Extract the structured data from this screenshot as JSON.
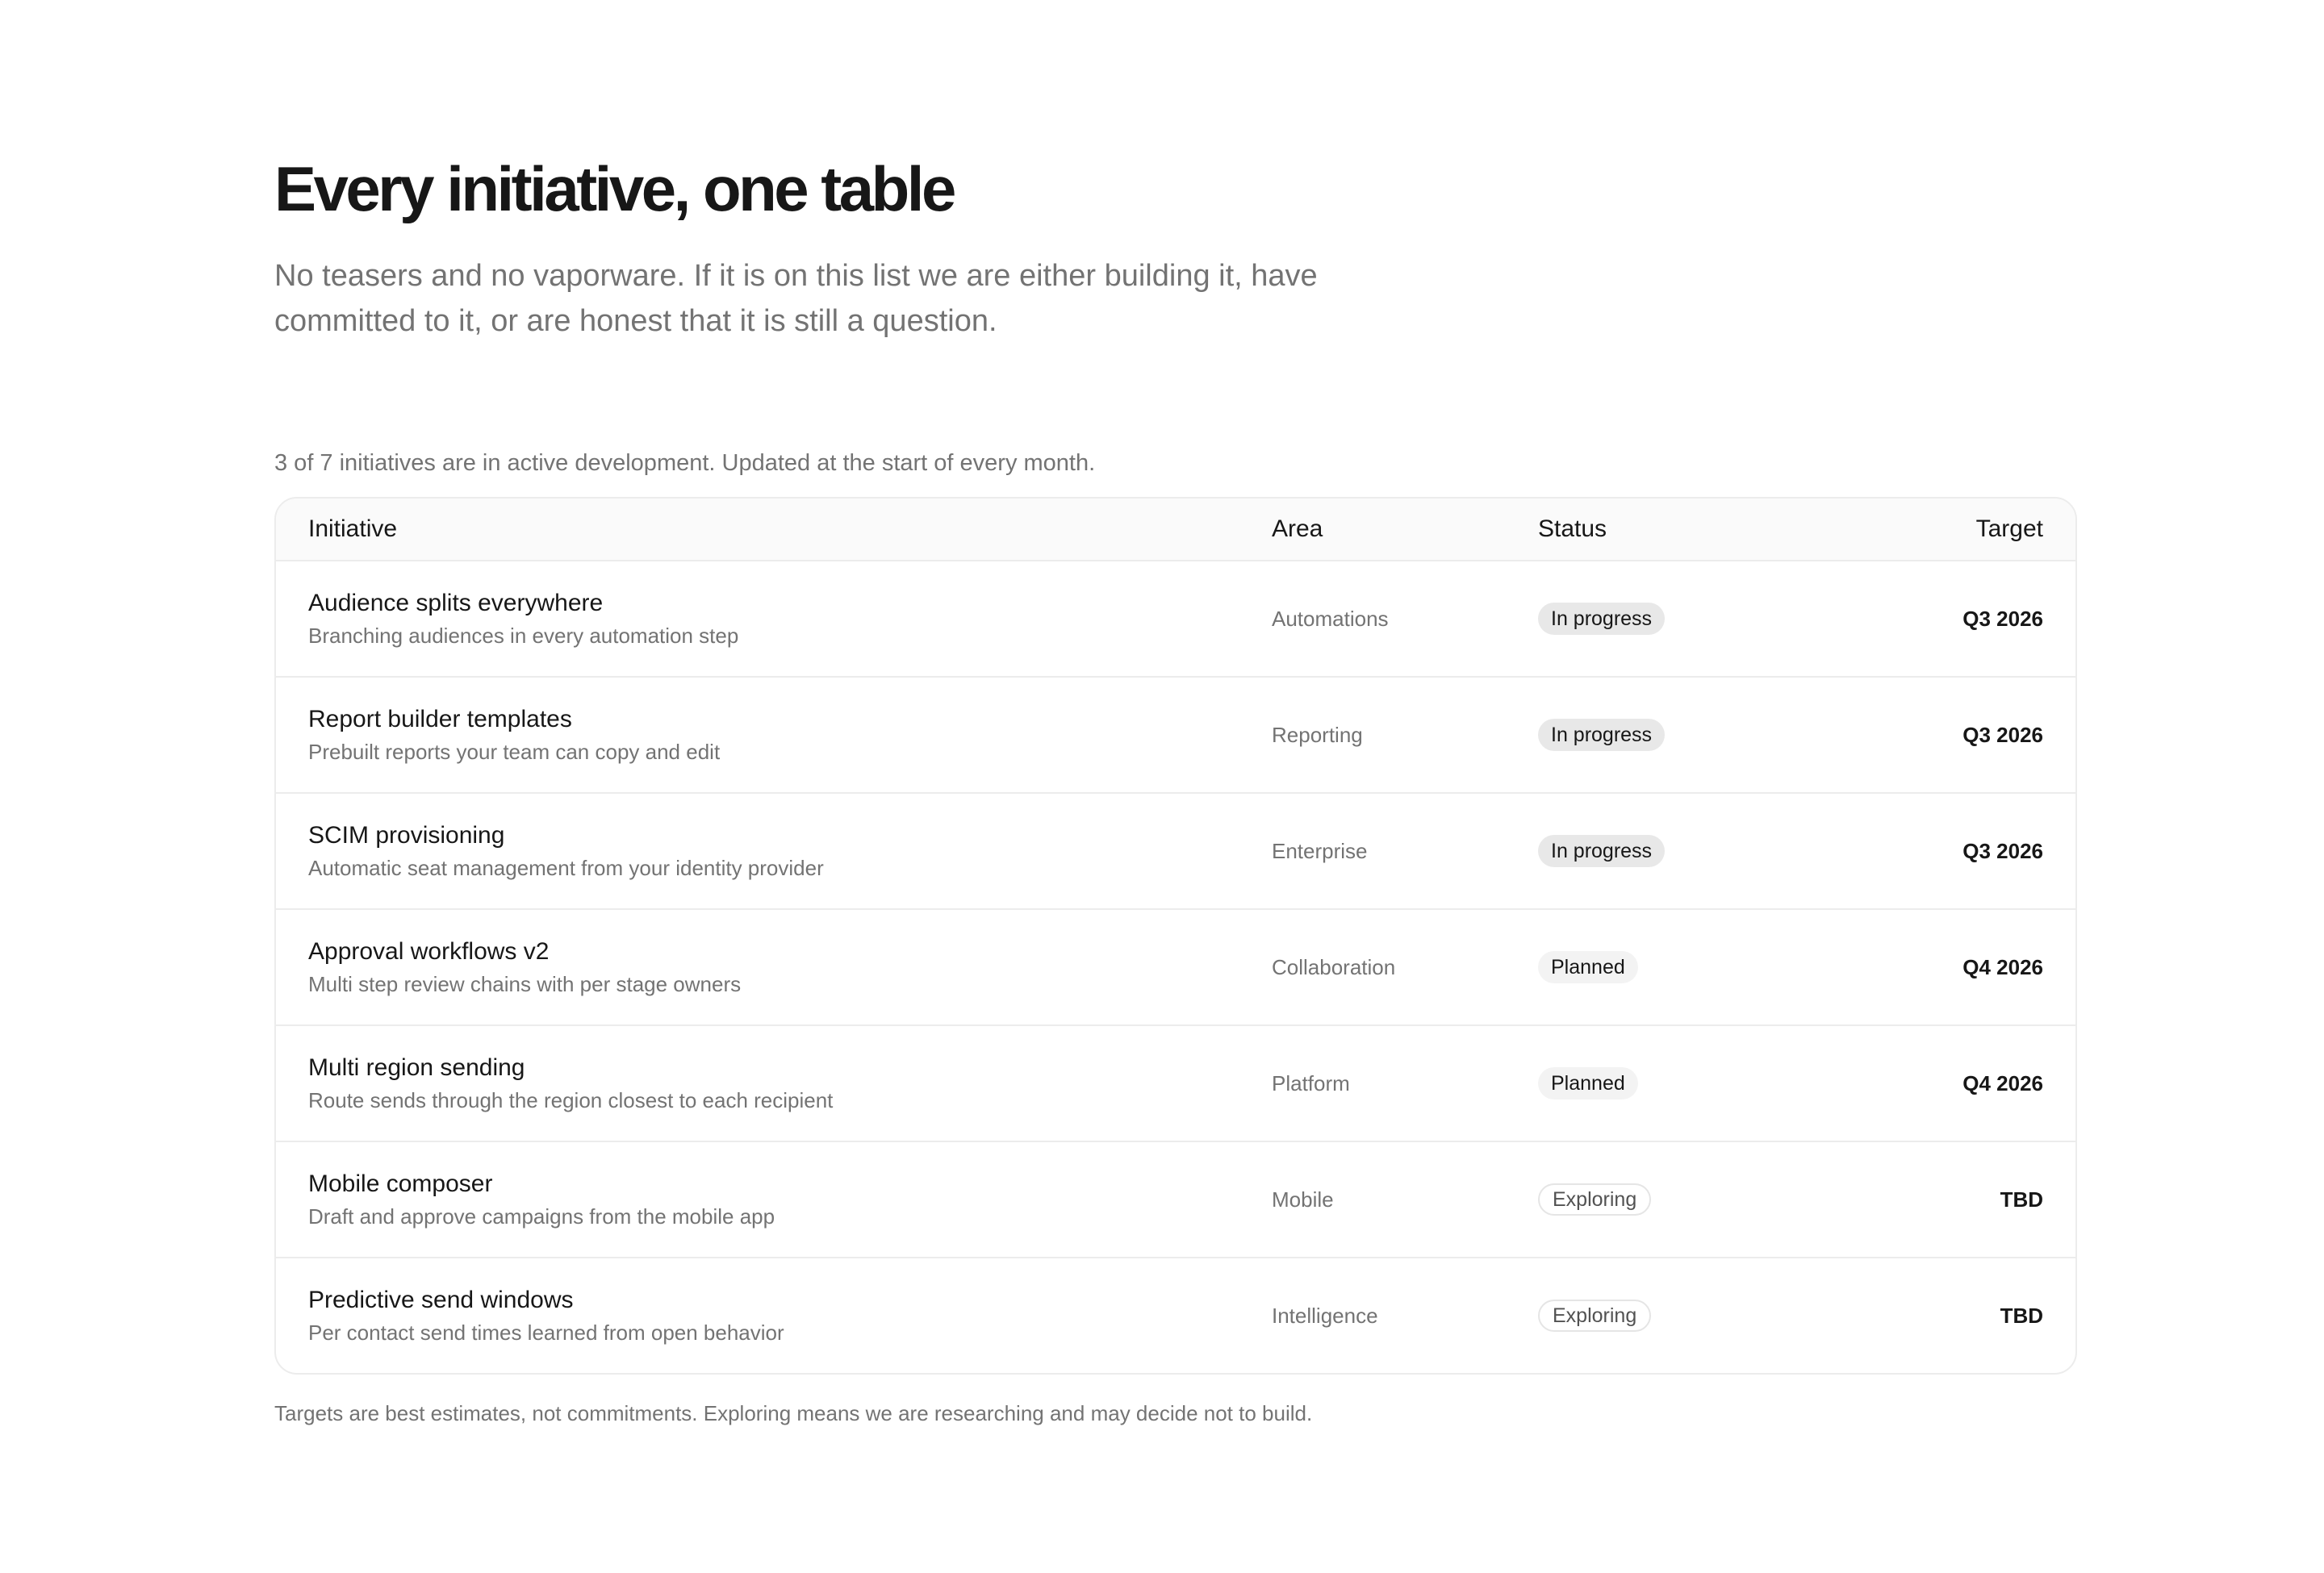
{
  "header": {
    "title": "Every initiative, one table",
    "subtitle": "No teasers and no vaporware. If it is on this list we are either building it, have committed to it, or are honest that it is still a question."
  },
  "summary": "3 of 7 initiatives are in active development. Updated at the start of every month.",
  "table": {
    "columns": {
      "initiative": "Initiative",
      "area": "Area",
      "status": "Status",
      "target": "Target"
    },
    "rows": [
      {
        "name": "Audience splits everywhere",
        "description": "Branching audiences in every automation step",
        "area": "Automations",
        "status": "In progress",
        "target": "Q3 2026"
      },
      {
        "name": "Report builder templates",
        "description": "Prebuilt reports your team can copy and edit",
        "area": "Reporting",
        "status": "In progress",
        "target": "Q3 2026"
      },
      {
        "name": "SCIM provisioning",
        "description": "Automatic seat management from your identity provider",
        "area": "Enterprise",
        "status": "In progress",
        "target": "Q3 2026"
      },
      {
        "name": "Approval workflows v2",
        "description": "Multi step review chains with per stage owners",
        "area": "Collaboration",
        "status": "Planned",
        "target": "Q4 2026"
      },
      {
        "name": "Multi region sending",
        "description": "Route sends through the region closest to each recipient",
        "area": "Platform",
        "status": "Planned",
        "target": "Q4 2026"
      },
      {
        "name": "Mobile composer",
        "description": "Draft and approve campaigns from the mobile app",
        "area": "Mobile",
        "status": "Exploring",
        "target": "TBD"
      },
      {
        "name": "Predictive send windows",
        "description": "Per contact send times learned from open behavior",
        "area": "Intelligence",
        "status": "Exploring",
        "target": "TBD"
      }
    ]
  },
  "footnote": "Targets are best estimates, not commitments. Exploring means we are researching and may decide not to build.",
  "colors": {
    "text_primary": "#171717",
    "text_muted": "#737373",
    "border": "#ececec",
    "header_bg": "#fafafa",
    "badge_in_progress_bg": "#e8e8e8",
    "badge_planned_bg": "#f3f3f3",
    "badge_exploring_border": "#e5e5e5"
  }
}
